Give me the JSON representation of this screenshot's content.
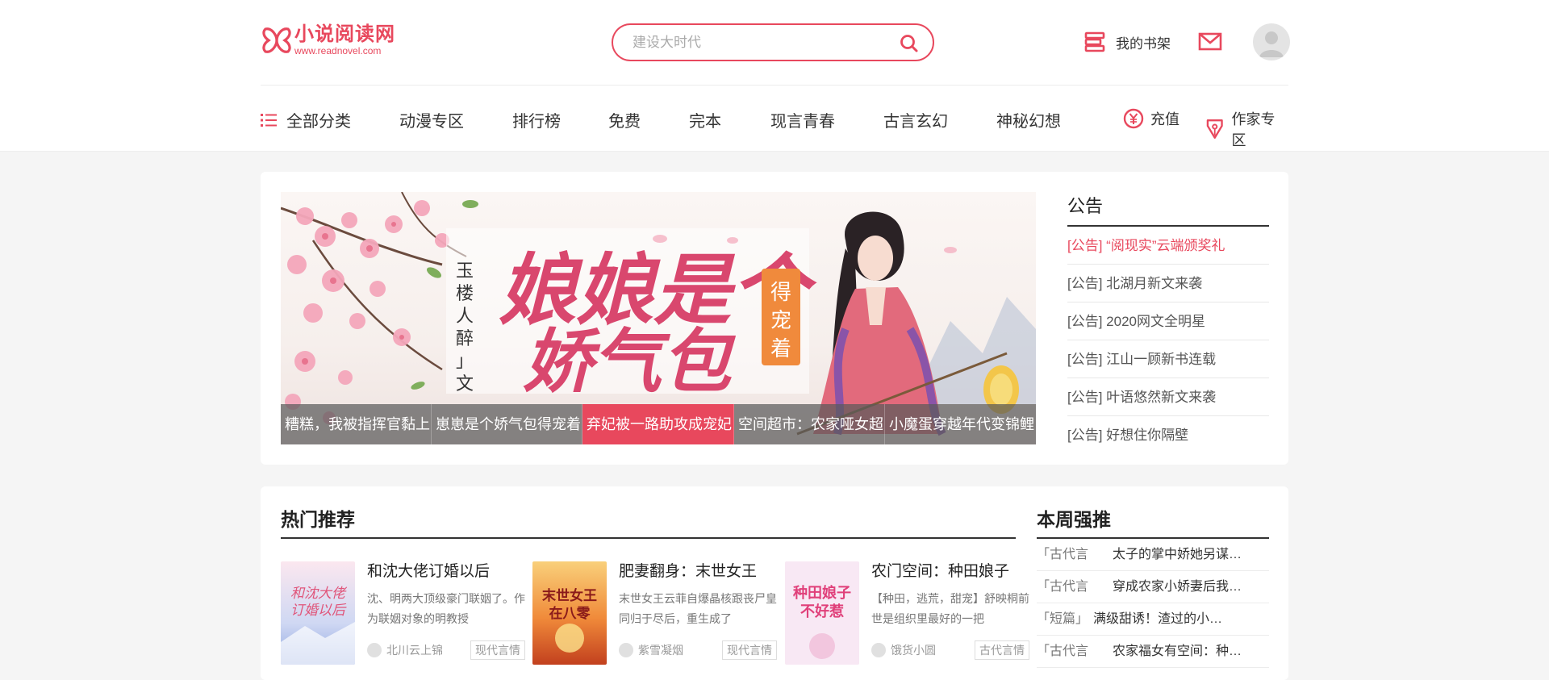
{
  "header": {
    "logo_cn": "小说阅读网",
    "logo_en": "www.readnovel.com",
    "search_placeholder": "建设大时代",
    "bookshelf_label": "我的书架"
  },
  "nav": {
    "all_categories": "全部分类",
    "items": [
      "动漫专区",
      "排行榜",
      "免费",
      "完本",
      "现言青春",
      "古言玄幻",
      "神秘幻想"
    ],
    "recharge": "充值",
    "author_zone": "作家专区"
  },
  "banner": {
    "book_title": "娘娘是个娇气包",
    "book_title_side": "得宠着",
    "author_vertical": "玉楼人醉」文",
    "tabs": [
      "糟糕，我被指挥官黏上",
      "崽崽是个娇气包得宠着",
      "弃妃被一路助攻成宠妃",
      "空间超市：农家哑女超",
      "小魔蛋穿越年代变锦鲤"
    ],
    "active_tab": 2
  },
  "notice": {
    "title": "公告",
    "items": [
      "[公告] “阅现实”云端颁奖礼",
      "[公告] 北湖月新文来袭",
      "[公告] 2020网文全明星",
      "[公告] 江山一顾新书连载",
      "[公告] 叶语悠然新文来袭",
      "[公告] 好想住你隔壁"
    ]
  },
  "hot": {
    "title": "热门推荐",
    "books": [
      {
        "title": "和沈大佬订婚以后",
        "desc": "沈、明两大顶级豪门联姻了。作为联姻对象的明教授",
        "author": "北川云上锦",
        "tag": "现代言情",
        "cover_text": "和沈大佬订婚以后"
      },
      {
        "title": "肥妻翻身：末世女王",
        "desc": "末世女王云菲自爆晶核跟丧尸皇同归于尽后，重生成了",
        "author": "紫雪凝烟",
        "tag": "现代言情",
        "cover_text": "末世女王在八零"
      },
      {
        "title": "农门空间：种田娘子",
        "desc": "【种田，逃荒，甜宠】舒映桐前世是组织里最好的一把",
        "author": "饿货小圆",
        "tag": "古代言情",
        "cover_text": "种田娘子不好惹"
      }
    ]
  },
  "week": {
    "title": "本周强推",
    "items": [
      {
        "cat": "「古代言",
        "name": "太子的掌中娇她另谋…"
      },
      {
        "cat": "「古代言",
        "name": "穿成农家小娇妻后我…"
      },
      {
        "cat": "「短篇」",
        "name": "满级甜诱！渣过的小…"
      },
      {
        "cat": "「古代言",
        "name": "农家福女有空间：种…"
      }
    ]
  },
  "colors": {
    "accent": "#e8485d",
    "bg": "#f5f5f5"
  }
}
